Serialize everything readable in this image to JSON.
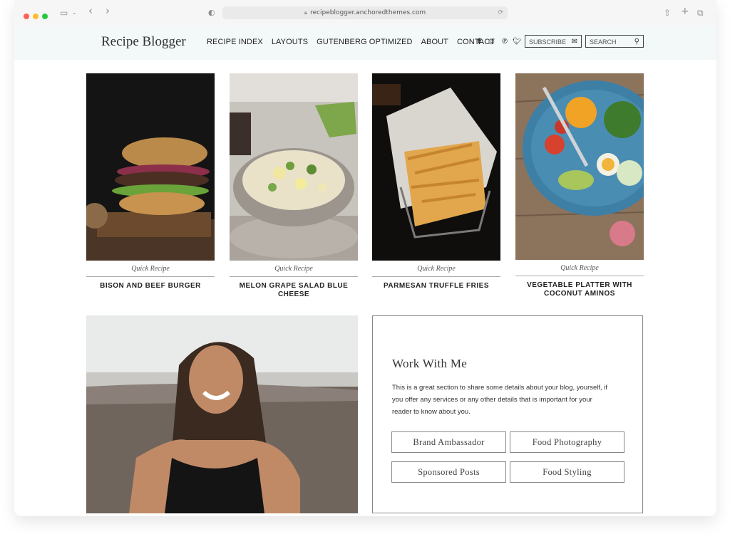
{
  "browser": {
    "url": "recipeblogger.anchoredthemes.com"
  },
  "site": {
    "logo": "Recipe Blogger",
    "nav": [
      "RECIPE INDEX",
      "LAYOUTS",
      "GUTENBERG OPTIMIZED",
      "ABOUT",
      "CONTACT"
    ],
    "social": [
      "facebook-icon",
      "instagram-icon",
      "pinterest-icon",
      "twitter-icon"
    ],
    "subscribe_label": "SUBSCRIBE",
    "search_placeholder": "SEARCH"
  },
  "recipes": [
    {
      "category": "Quick Recipe",
      "title": "BISON AND BEEF BURGER"
    },
    {
      "category": "Quick Recipe",
      "title": "MELON GRAPE SALAD BLUE CHEESE"
    },
    {
      "category": "Quick Recipe",
      "title": "PARMESAN TRUFFLE FRIES"
    },
    {
      "category": "Quick Recipe",
      "title": "VEGETABLE PLATTER WITH COCONUT AMINOS"
    }
  ],
  "work_with_me": {
    "heading": "Work With Me",
    "body": "This is a great section to share some details about your blog, yourself, if you offer any services or any other details that is important for your reader to know about you.",
    "services": [
      "Brand Ambassador",
      "Food Photography",
      "Sponsored Posts",
      "Food Styling"
    ]
  },
  "colors": {
    "header_bg": "#f3f8f8",
    "window_chrome": "#f6f6f6",
    "traffic_red": "#ff5f57",
    "traffic_yellow": "#febc2e",
    "traffic_green": "#28c840"
  }
}
